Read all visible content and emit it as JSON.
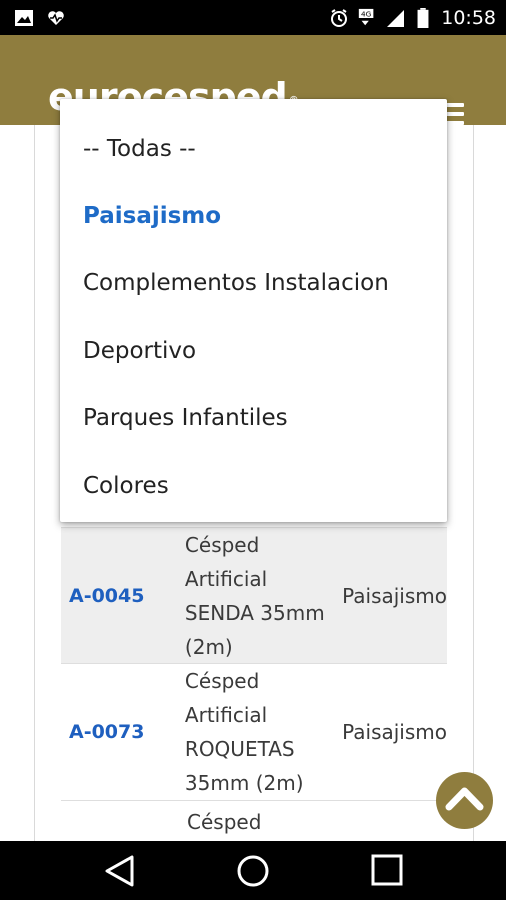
{
  "status_bar": {
    "time": "10:58",
    "icons": [
      "image-icon",
      "heart-icon",
      "alarm-icon",
      "4g-signal-icon",
      "signal-bars-icon",
      "battery-icon"
    ],
    "network_label": "4G"
  },
  "header": {
    "logo_text": "eurocesped",
    "logo_mark": "®",
    "menu_icon": "hamburger-menu-icon",
    "bg_color": "#8f7d3e"
  },
  "dropdown": {
    "options": [
      {
        "label": "-- Todas --",
        "selected": false
      },
      {
        "label": "Paisajismo",
        "selected": true
      },
      {
        "label": "Complementos Instalacion",
        "selected": false
      },
      {
        "label": "Deportivo",
        "selected": false
      },
      {
        "label": "Parques Infantiles",
        "selected": false
      },
      {
        "label": "Colores",
        "selected": false
      }
    ],
    "selected_color": "#1e6bc7"
  },
  "products": {
    "rows": [
      {
        "code": "A-0045",
        "name": "Césped Artificial SENDA 35mm (2m)",
        "category": "Paisajismo"
      },
      {
        "code": "A-0073",
        "name": "Césped Artificial ROQUETAS 35mm (2m)",
        "category": "Paisajismo"
      },
      {
        "code": "",
        "name": "Césped Artificial",
        "category": ""
      }
    ]
  },
  "fab": {
    "icon": "chevron-up-icon"
  },
  "nav_bar": {
    "buttons": [
      "back-icon",
      "home-icon",
      "recents-icon"
    ]
  }
}
